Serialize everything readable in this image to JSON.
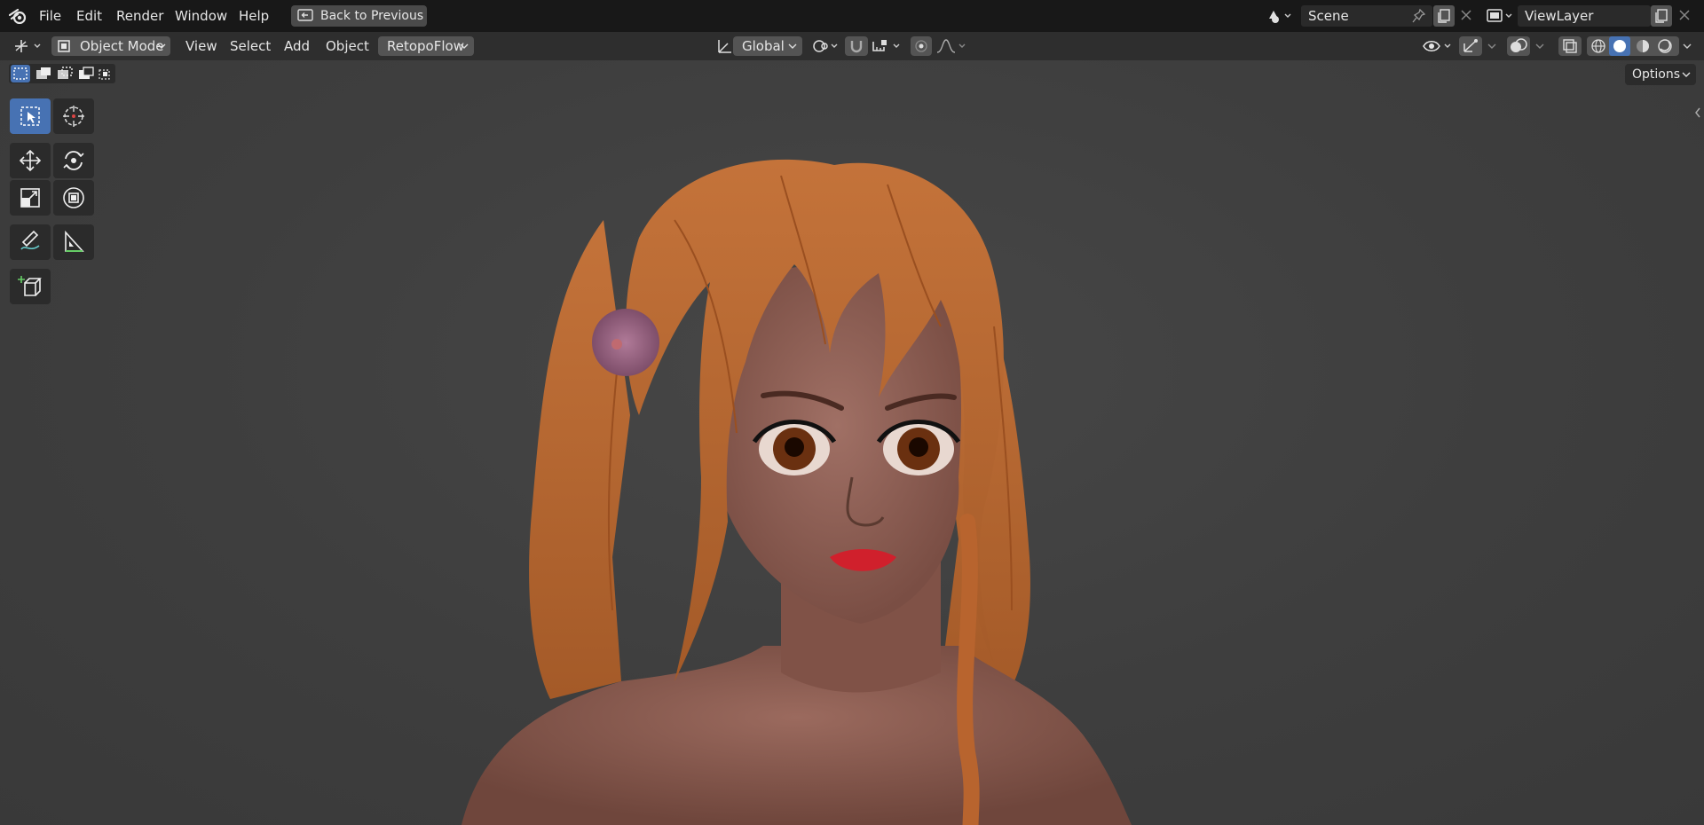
{
  "topbar": {
    "menu": [
      "File",
      "Edit",
      "Render",
      "Window",
      "Help"
    ],
    "back_button": "Back to Previous",
    "scene_name": "Scene",
    "view_layer": "ViewLayer"
  },
  "header": {
    "mode": "Object Mode",
    "menus": [
      "View",
      "Select",
      "Add",
      "Object"
    ],
    "addon_menu": "RetopoFlow",
    "transform_orientation": "Global",
    "options_label": "Options"
  },
  "toolbar": {
    "tools": [
      {
        "name": "select-box",
        "active": true
      },
      {
        "name": "cursor",
        "active": false
      },
      {
        "name": "move",
        "active": false
      },
      {
        "name": "rotate",
        "active": false
      },
      {
        "name": "scale",
        "active": false
      },
      {
        "name": "transform",
        "active": false
      },
      {
        "name": "annotate",
        "active": false
      },
      {
        "name": "measure",
        "active": false
      },
      {
        "name": "add-cube",
        "active": false
      }
    ]
  },
  "colors": {
    "active_tool": "#4772b3",
    "viewport_bg": "#3d3d3d",
    "hair": "#b8642e",
    "skin": "#8a5a4f",
    "lips": "#d0202c",
    "flower": "#a0688a"
  }
}
